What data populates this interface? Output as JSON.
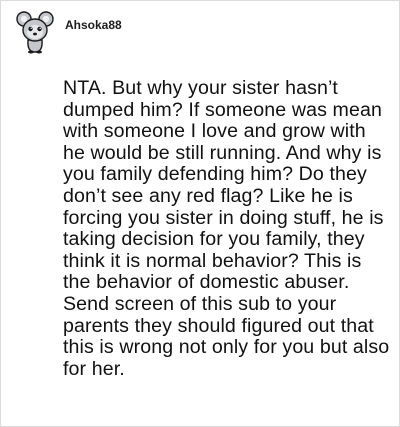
{
  "comment": {
    "author": {
      "username": "Ahsoka88",
      "avatar_icon": "snoo-avatar-icon"
    },
    "body": "NTA. But why your sister hasn’t dumped him? If someone was mean with someone I love and grow with he would be still running. And why is you family defending him? Do they don’t see any red flag? Like he is forcing you sister in doing stuff, he is taking decision for you family, they think it is normal behavior? This is the behavior of domestic abuser. Send screen of this sub to your parents they should figured out that this is wrong not only for you but also for her."
  },
  "colors": {
    "background": "#ffffff",
    "border": "#dcdcdc",
    "text": "#111111",
    "avatar_body": "#c4c7cb",
    "avatar_outline": "#1a1a1a"
  }
}
